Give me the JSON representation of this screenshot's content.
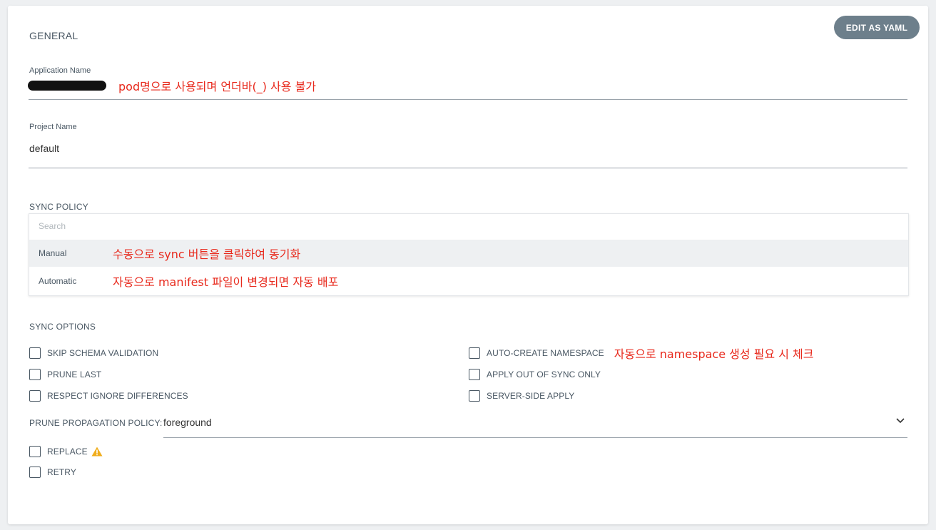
{
  "header": {
    "edit_yaml_label": "EDIT AS YAML"
  },
  "general": {
    "title": "GENERAL",
    "application_name_label": "Application Name",
    "application_name_annotation": "pod명으로 사용되며 언더바(_) 사용 불가",
    "project_name_label": "Project Name",
    "project_name_value": "default"
  },
  "sync_policy": {
    "title": "SYNC POLICY",
    "search_placeholder": "Search",
    "options": [
      {
        "label": "Manual",
        "annotation": "수동으로 sync 버튼을 클릭하여 동기화"
      },
      {
        "label": "Automatic",
        "annotation": "자동으로 manifest 파일이 변경되면 자동 배포"
      }
    ]
  },
  "sync_options": {
    "title": "SYNC OPTIONS",
    "left": [
      {
        "label": "SKIP SCHEMA VALIDATION"
      },
      {
        "label": "PRUNE LAST"
      },
      {
        "label": "RESPECT IGNORE DIFFERENCES"
      }
    ],
    "right": [
      {
        "label": "AUTO-CREATE NAMESPACE",
        "annotation": "자동으로 namespace 생성 필요 시 체크"
      },
      {
        "label": "APPLY OUT OF SYNC ONLY"
      },
      {
        "label": "SERVER-SIDE APPLY"
      }
    ],
    "prune_propagation_label": "PRUNE PROPAGATION POLICY:",
    "prune_propagation_value": "foreground",
    "bottom": [
      {
        "label": "REPLACE"
      },
      {
        "label": "RETRY"
      }
    ]
  },
  "colors": {
    "annotation": "#e8291c",
    "button": "#6d7f8b",
    "warning": "#f0ad1c"
  },
  "icons": {
    "replace_warning": "warning-triangle-icon",
    "dropdown": "chevron-down-icon"
  }
}
